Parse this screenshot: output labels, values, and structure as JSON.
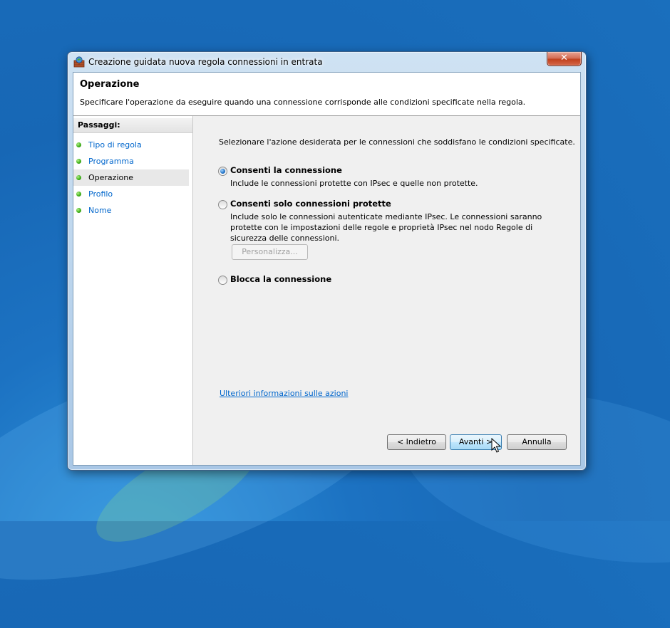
{
  "window": {
    "title": "Creazione guidata nuova regola connessioni in entrata",
    "close_symbol": "✕",
    "icon": "firewall-icon"
  },
  "header": {
    "title": "Operazione",
    "description": "Specificare l'operazione da eseguire quando una connessione corrisponde alle condizioni specificate nella regola."
  },
  "steps": {
    "heading": "Passaggi:",
    "items": [
      {
        "label": "Tipo di regola",
        "current": false
      },
      {
        "label": "Programma",
        "current": false
      },
      {
        "label": "Operazione",
        "current": true
      },
      {
        "label": "Profilo",
        "current": false
      },
      {
        "label": "Nome",
        "current": false
      }
    ]
  },
  "main": {
    "instruction": "Selezionare l'azione desiderata per le connessioni che soddisfano le condizioni specificate.",
    "options": [
      {
        "label": "Consenti la connessione",
        "description": "Include le connessioni protette con IPsec e quelle non protette.",
        "selected": true
      },
      {
        "label": "Consenti solo connessioni protette",
        "description": "Include solo le connessioni autenticate mediante IPsec. Le connessioni saranno protette con le impostazioni delle regole e proprietà IPsec nel nodo Regole di sicurezza delle connessioni.",
        "selected": false
      },
      {
        "label": "Blocca la connessione",
        "description": "",
        "selected": false
      }
    ],
    "customize_button": "Personalizza...",
    "more_info_link": "Ulteriori informazioni sulle azioni"
  },
  "buttons": {
    "back": "< Indietro",
    "next": "Avanti >",
    "cancel": "Annulla"
  }
}
